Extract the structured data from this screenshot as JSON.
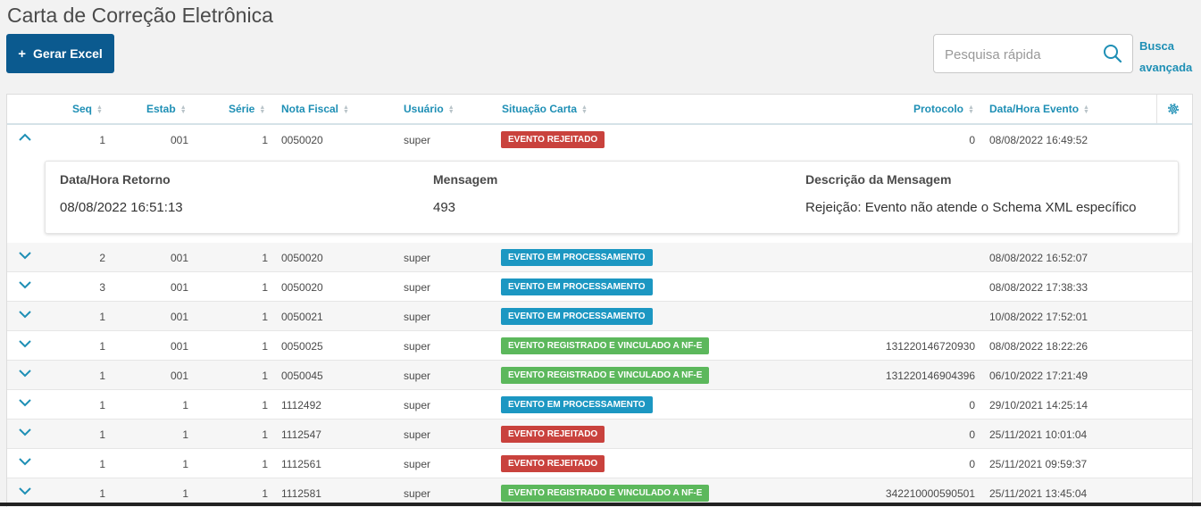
{
  "page": {
    "title": "Carta de Correção Eletrônica"
  },
  "toolbar": {
    "excel_label": "Gerar Excel",
    "excel_plus": "+"
  },
  "search": {
    "placeholder": "Pesquisa rápida",
    "advanced_line1": "Busca",
    "advanced_line2": "avançada"
  },
  "columns": {
    "seq": "Seq",
    "estab": "Estab",
    "serie": "Série",
    "nota": "Nota Fiscal",
    "usuario": "Usuário",
    "situacao": "Situação Carta",
    "protocolo": "Protocolo",
    "data": "Data/Hora Evento"
  },
  "expanded_row": {
    "seq": "1",
    "estab": "001",
    "serie": "1",
    "nota": "0050020",
    "usuario": "super",
    "situacao": "EVENTO REJEITADO",
    "status": "rejeitado",
    "protocolo": "0",
    "data": "08/08/2022 16:49:52"
  },
  "detail": {
    "retorno_label": "Data/Hora Retorno",
    "retorno_value": "08/08/2022 16:51:13",
    "mensagem_label": "Mensagem",
    "mensagem_value": "493",
    "descricao_label": "Descrição da Mensagem",
    "descricao_value": "Rejeição: Evento não atende o Schema XML específico"
  },
  "rows": [
    {
      "seq": "2",
      "estab": "001",
      "serie": "1",
      "nota": "0050020",
      "usuario": "super",
      "situacao": "EVENTO EM PROCESSAMENTO",
      "status": "proc",
      "protocolo": "",
      "data": "08/08/2022 16:52:07"
    },
    {
      "seq": "3",
      "estab": "001",
      "serie": "1",
      "nota": "0050020",
      "usuario": "super",
      "situacao": "EVENTO EM PROCESSAMENTO",
      "status": "proc",
      "protocolo": "",
      "data": "08/08/2022 17:38:33"
    },
    {
      "seq": "1",
      "estab": "001",
      "serie": "1",
      "nota": "0050021",
      "usuario": "super",
      "situacao": "EVENTO EM PROCESSAMENTO",
      "status": "proc",
      "protocolo": "",
      "data": "10/08/2022 17:52:01"
    },
    {
      "seq": "1",
      "estab": "001",
      "serie": "1",
      "nota": "0050025",
      "usuario": "super",
      "situacao": "EVENTO REGISTRADO E VINCULADO A NF-E",
      "status": "reg",
      "protocolo": "131220146720930",
      "data": "08/08/2022 18:22:26"
    },
    {
      "seq": "1",
      "estab": "001",
      "serie": "1",
      "nota": "0050045",
      "usuario": "super",
      "situacao": "EVENTO REGISTRADO E VINCULADO A NF-E",
      "status": "reg",
      "protocolo": "131220146904396",
      "data": "06/10/2022 17:21:49"
    },
    {
      "seq": "1",
      "estab": "1",
      "serie": "1",
      "nota": "1112492",
      "usuario": "super",
      "situacao": "EVENTO EM PROCESSAMENTO",
      "status": "proc",
      "protocolo": "0",
      "data": "29/10/2021 14:25:14"
    },
    {
      "seq": "1",
      "estab": "1",
      "serie": "1",
      "nota": "1112547",
      "usuario": "super",
      "situacao": "EVENTO REJEITADO",
      "status": "rej",
      "protocolo": "0",
      "data": "25/11/2021 10:01:04"
    },
    {
      "seq": "1",
      "estab": "1",
      "serie": "1",
      "nota": "1112561",
      "usuario": "super",
      "situacao": "EVENTO REJEITADO",
      "status": "rej",
      "protocolo": "0",
      "data": "25/11/2021 09:59:37"
    },
    {
      "seq": "1",
      "estab": "1",
      "serie": "1",
      "nota": "1112581",
      "usuario": "super",
      "situacao": "EVENTO REGISTRADO E VINCULADO A NF-E",
      "status": "reg",
      "protocolo": "342210000590501",
      "data": "25/11/2021 13:45:04"
    }
  ],
  "colors": {
    "primary": "#0b5a8f",
    "link": "#1e8fb5",
    "rejeitado": "#c9423d",
    "processamento": "#1c97c2",
    "registrado": "#5cb85c"
  }
}
